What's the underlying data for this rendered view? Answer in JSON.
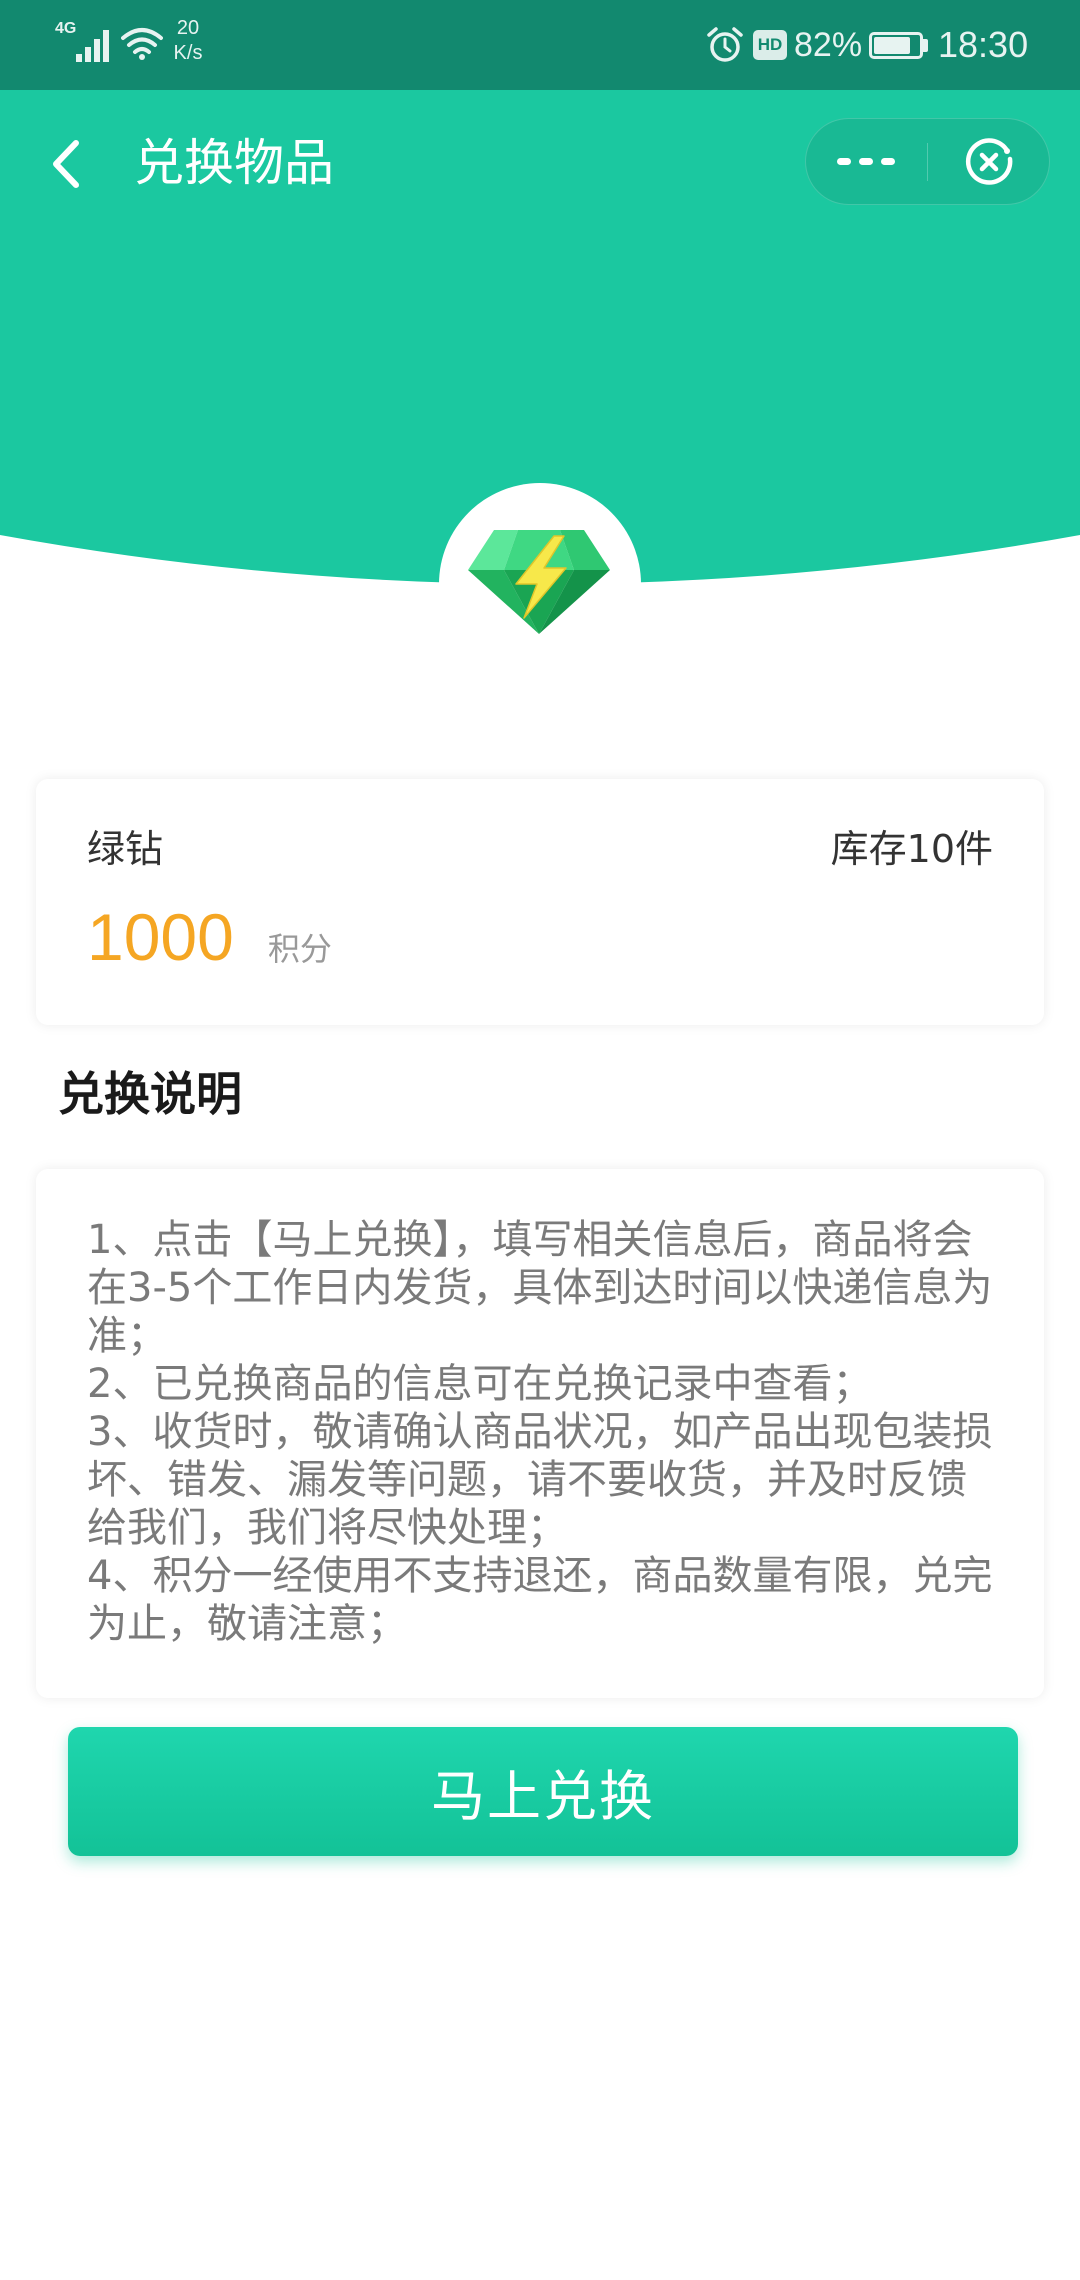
{
  "status_bar": {
    "network": "4G",
    "speed_value": "20",
    "speed_unit": "K/s",
    "hd_label": "HD",
    "battery_text": "82%",
    "battery_level": 0.82,
    "time": "18:30",
    "icons": [
      "signal-icon",
      "wifi-icon",
      "alarm-icon",
      "battery-icon"
    ]
  },
  "nav": {
    "title": "兑换物品",
    "back_icon": "chevron-left-icon",
    "more_icon": "more-dots-icon",
    "close_icon": "close-circle-icon"
  },
  "hero": {
    "icon": "green-diamond-lightning-icon"
  },
  "product": {
    "name": "绿钻",
    "stock": "库存10件",
    "points": "1000",
    "points_unit": "积分"
  },
  "instructions": {
    "heading": "兑换说明",
    "items": [
      "1、点击【马上兑换】，填写相关信息后，商品将会在3-5个工作日内发货，具体到达时间以快递信息为准；",
      "2、已兑换商品的信息可在兑换记录中查看；",
      "3、收货时，敬请确认商品状况，如产品出现包装损坏、错发、漏发等问题，请不要收货，并及时反馈给我们，我们将尽快处理；",
      "4、积分一经使用不支持退还，商品数量有限，兑完为止，敬请注意；"
    ]
  },
  "actions": {
    "redeem_label": "马上兑换"
  },
  "colors": {
    "primary": "#1bc8a0",
    "status_bar": "#12896f",
    "points": "#f5a623",
    "button_top": "#1fd6ae",
    "button_bottom": "#13c297",
    "gem": "#2fc872",
    "bolt": "#f7e84a"
  }
}
